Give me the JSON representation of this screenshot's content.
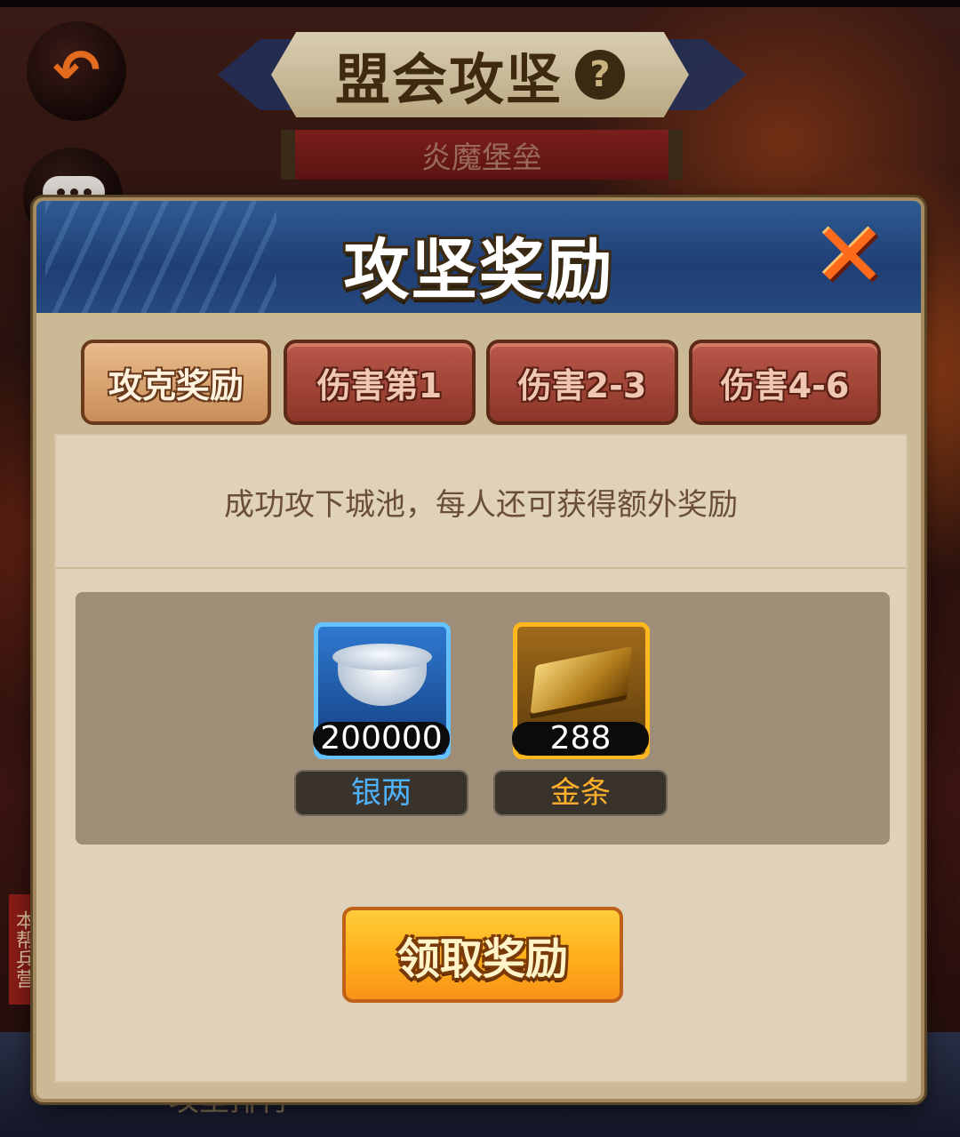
{
  "background": {
    "title": "盟会攻坚",
    "help_icon": "?",
    "subtitle": "炎魔堡垒",
    "side_note": "本帮兵营",
    "bottom_label": "攻坚排行"
  },
  "modal": {
    "title": "攻坚奖励",
    "close_icon": "close-icon",
    "tabs": [
      {
        "label": "攻克奖励",
        "active": true
      },
      {
        "label": "伤害第1",
        "active": false
      },
      {
        "label": "伤害2-3",
        "active": false
      },
      {
        "label": "伤害4-6",
        "active": false
      }
    ],
    "description": "成功攻下城池，每人还可获得额外奖励",
    "rewards": [
      {
        "count": "200000",
        "name": "银两",
        "name_color": "#4fb2ff",
        "frame": "blue",
        "icon": "silver-ingot-icon"
      },
      {
        "count": "288",
        "name": "金条",
        "name_color": "#ffb02a",
        "frame": "gold",
        "icon": "gold-bar-icon"
      }
    ],
    "claim_label": "领取奖励"
  },
  "colors": {
    "header_blue": "#26497f",
    "tab_active": "#e8bb8a",
    "tab_inactive": "#b9584a",
    "claim_button": "#ffae18"
  }
}
